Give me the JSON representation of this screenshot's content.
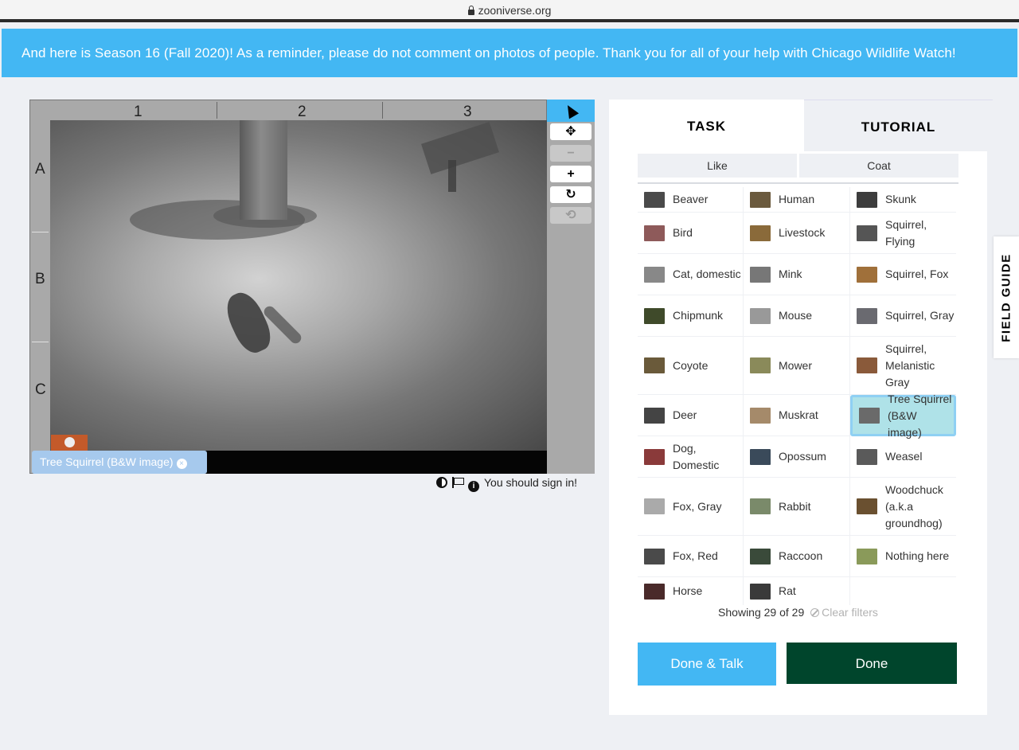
{
  "browser": {
    "url": "zooniverse.org"
  },
  "banner": {
    "text": "And here is Season 16 (Fall 2020)! As a reminder, please do not comment on photos of people. Thank you for all of your help with Chicago Wildlife Watch!"
  },
  "viewer": {
    "columns": [
      "1",
      "2",
      "3"
    ],
    "rows": [
      "A",
      "B",
      "C"
    ],
    "subject_tag": "Tree Squirrel (B&W image)",
    "tag_close": "×",
    "tools": {
      "move": "✥",
      "zoom_out": "−",
      "zoom_in": "+",
      "rotate": "↻",
      "reset": "⟲"
    },
    "sign_in": "You should sign in!"
  },
  "panel": {
    "tabs": {
      "task": "TASK",
      "tutorial": "TUTORIAL"
    },
    "filters": {
      "like": "Like",
      "coat": "Coat"
    },
    "choices": [
      {
        "label": "Beaver",
        "color": "#4a4a4a"
      },
      {
        "label": "Human",
        "color": "#6b5a3e"
      },
      {
        "label": "Skunk",
        "color": "#3d3d3d"
      },
      {
        "label": "Bird",
        "color": "#8e5a5a"
      },
      {
        "label": "Livestock",
        "color": "#8a6a3a"
      },
      {
        "label": "Squirrel, Flying",
        "color": "#555"
      },
      {
        "label": "Cat, domestic",
        "color": "#888"
      },
      {
        "label": "Mink",
        "color": "#777"
      },
      {
        "label": "Squirrel, Fox",
        "color": "#a0703a"
      },
      {
        "label": "Chipmunk",
        "color": "#3f4a2a"
      },
      {
        "label": "Mouse",
        "color": "#999"
      },
      {
        "label": "Squirrel, Gray",
        "color": "#6a6a70"
      },
      {
        "label": "Coyote",
        "color": "#6a5a3a"
      },
      {
        "label": "Mower",
        "color": "#8a8a5a"
      },
      {
        "label": "Squirrel, Melanistic Gray",
        "color": "#8a5a3a"
      },
      {
        "label": "Deer",
        "color": "#444"
      },
      {
        "label": "Muskrat",
        "color": "#a58a6a"
      },
      {
        "label": "Tree Squirrel (B&W image)",
        "color": "#6a6a6a"
      },
      {
        "label": "Dog, Domestic",
        "color": "#8a3a3a"
      },
      {
        "label": "Opossum",
        "color": "#3a4a5a"
      },
      {
        "label": "Weasel",
        "color": "#5a5a5a"
      },
      {
        "label": "Fox, Gray",
        "color": "#aaa"
      },
      {
        "label": "Rabbit",
        "color": "#7a8a6a"
      },
      {
        "label": "Woodchuck (a.k.a groundhog)",
        "color": "#6a5030"
      },
      {
        "label": "Fox, Red",
        "color": "#4a4a4a"
      },
      {
        "label": "Raccoon",
        "color": "#3a4a3a"
      },
      {
        "label": "Nothing here",
        "color": "#8a9a5a"
      },
      {
        "label": "Horse",
        "color": "#4a2a2a"
      },
      {
        "label": "Rat",
        "color": "#3a3a3a"
      }
    ],
    "selected_choice": "Tree Squirrel (B&W image)",
    "showing": "Showing 29 of 29",
    "clear_filters": "Clear filters",
    "buttons": {
      "done_talk": "Done & Talk",
      "done": "Done"
    }
  },
  "field_guide": {
    "label": "FIELD GUIDE"
  }
}
